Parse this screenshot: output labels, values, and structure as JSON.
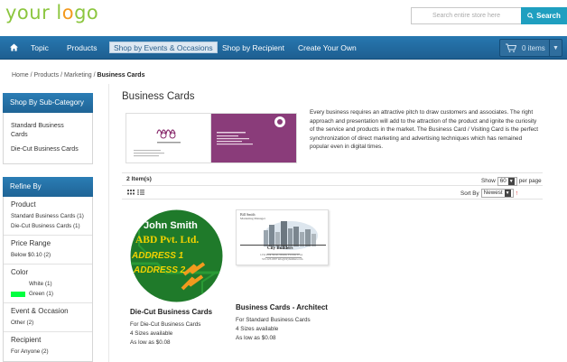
{
  "header": {
    "logo_part1": "your l",
    "logo_part2": "o",
    "logo_part3": "go",
    "search_placeholder": "Search entire store here",
    "search_button": "Search"
  },
  "nav": {
    "items": [
      "Topic",
      "Products",
      "Shop by Events & Occasions",
      "Shop by Recipient",
      "Create Your Own"
    ],
    "cart_label": "0 items"
  },
  "breadcrumb": {
    "path": "Home / Products / Marketing /",
    "current": "Business Cards"
  },
  "sidebar": {
    "subcat_title": "Shop By Sub-Category",
    "subcats": [
      "Standard Business Cards",
      "Die-Cut Business Cards"
    ],
    "refine_title": "Refine By",
    "filters": [
      {
        "title": "Product",
        "options": [
          "Standard Business Cards (1)",
          "Die-Cut Business Cards (1)"
        ]
      },
      {
        "title": "Price Range",
        "options": [
          "Below $0.10 (2)"
        ]
      },
      {
        "title": "Color",
        "options": [
          "White (1)",
          "Green (1)"
        ]
      },
      {
        "title": "Event & Occasion",
        "options": [
          "Other (2)"
        ]
      },
      {
        "title": "Recipient",
        "options": [
          "For Anyone (2)"
        ]
      }
    ],
    "colors": {
      "white": "#ffffff",
      "green": "#00ff40"
    }
  },
  "main": {
    "title": "Business Cards",
    "description": "Every business requires an attractive pitch to draw customers and associates. The right approach and presentation will add to the attraction of the product and ignite the curiosity of the service and products in the market. The Business Card / Visiting Card is the perfect synchronization of direct marketing and advertising techniques which has remained popular even in digital times.",
    "item_count": "2 Item(s)",
    "show_label": "Show",
    "per_page_value": "60",
    "per_page_label": "per page",
    "sort_label": "Sort By",
    "sort_value": "Newest"
  },
  "products": [
    {
      "name": "Die-Cut Business Cards",
      "category": "For Die-Cut Business Cards",
      "sizes": "4 Sizes available",
      "price": "As low as $0.08",
      "img_lines": [
        "John Smith",
        "ABD Pvt. Ltd.",
        "ADDRESS 1",
        "ADDRESS 2"
      ]
    },
    {
      "name": "Business Cards - Architect",
      "category": "For Standard Business Cards",
      "sizes": "4 Sizes available",
      "price": "As low as $0.08",
      "img_lines": [
        "Bill Smith",
        "Marketing Manager",
        "City Builders",
        "1234 Park Street, Miami, Florida, USA",
        "555-123-4567 info@citybuilders.com"
      ]
    }
  ]
}
